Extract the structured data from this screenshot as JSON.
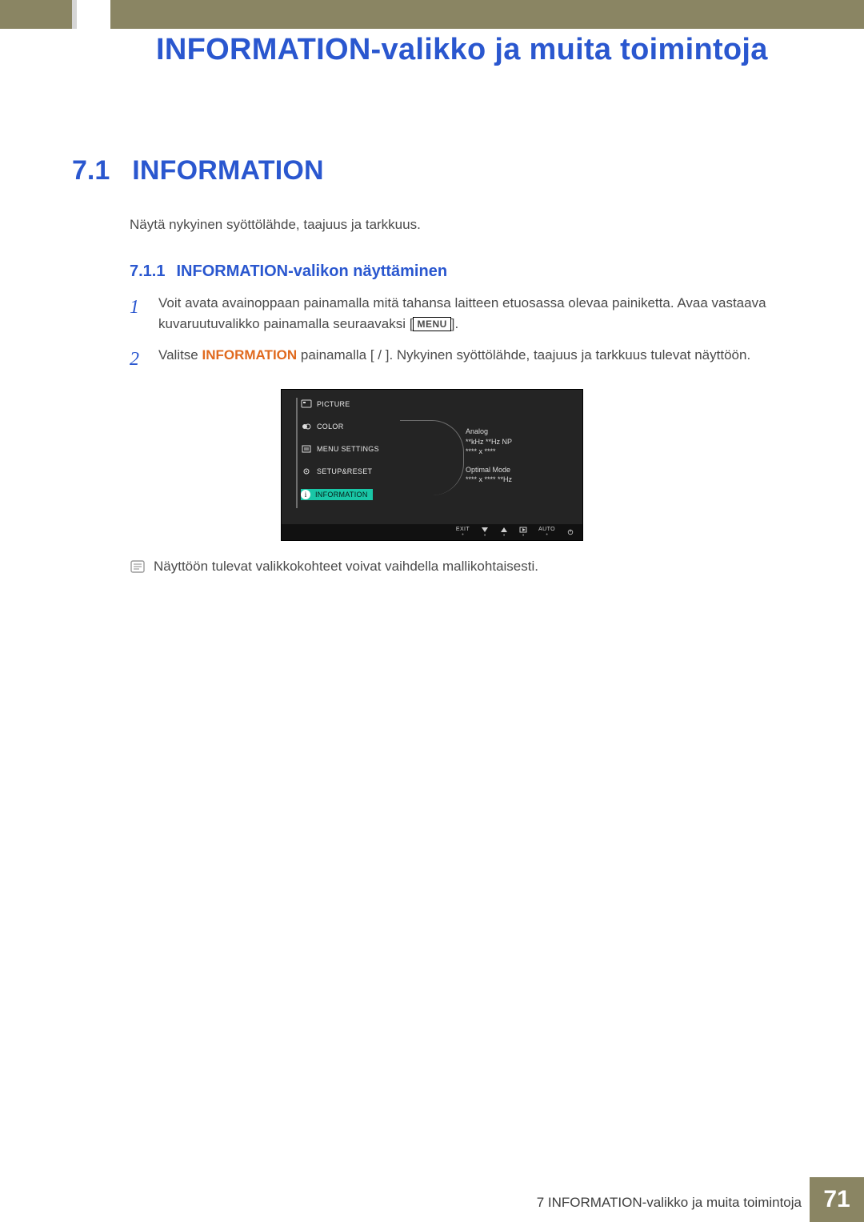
{
  "chapter_title": "INFORMATION-valikko ja muita toimintoja",
  "section": {
    "num": "7.1",
    "title": "INFORMATION"
  },
  "intro": "Näytä nykyinen syöttölähde, taajuus ja tarkkuus.",
  "subsection": {
    "num": "7.1.1",
    "title": "INFORMATION-valikon näyttäminen"
  },
  "steps": [
    {
      "n": "1",
      "pre": "Voit avata avainoppaan painamalla mitä tahansa laitteen etuosassa olevaa painiketta. Avaa vastaava kuvaruutuvalikko painamalla seuraavaksi [",
      "menu_label": "MENU",
      "post": "]."
    },
    {
      "n": "2",
      "pre": "Valitse ",
      "kw": "INFORMATION",
      "mid": " painamalla [",
      "post": "]. Nykyinen syöttölähde, taajuus ja tarkkuus tulevat näyttöön."
    }
  ],
  "note": "Näyttöön tulevat valikkokohteet voivat vaihdella mallikohtaisesti.",
  "osd": {
    "menu": [
      "PICTURE",
      "COLOR",
      "MENU SETTINGS",
      "SETUP&RESET",
      "INFORMATION"
    ],
    "selected_index": 4,
    "info": {
      "l1": "Analog",
      "l2": "**kHz  **Hz NP",
      "l3": "**** x ****",
      "l4": "Optimal Mode",
      "l5": "**** x ****  **Hz"
    },
    "buttons": {
      "exit": "EXIT",
      "auto": "AUTO"
    }
  },
  "footer": {
    "caption": "7 INFORMATION-valikko ja muita toimintoja",
    "page": "71"
  }
}
